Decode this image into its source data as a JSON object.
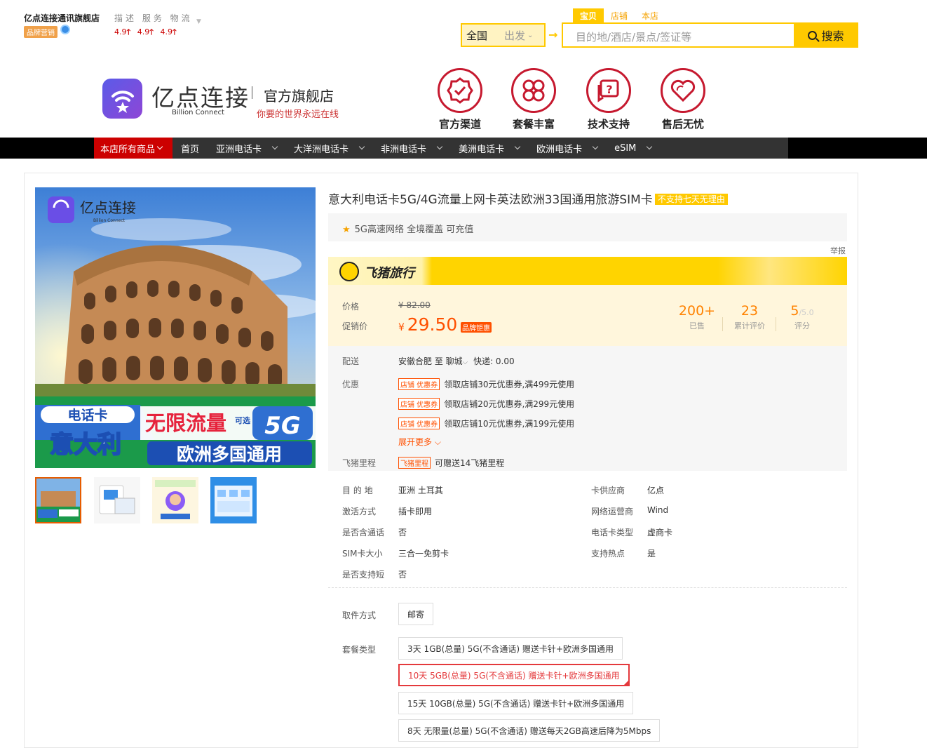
{
  "shop": {
    "name": "亿点连接通讯旗舰店",
    "badge": "品牌营销",
    "ratings_header": "描述 服务 物流",
    "ratings": [
      "4.9",
      "4.9",
      "4.9"
    ]
  },
  "search": {
    "tabs": [
      "宝贝",
      "店铺",
      "本店"
    ],
    "region": "全国",
    "depart": "出发",
    "placeholder": "目的地/酒店/景点/签证等",
    "button": "搜索"
  },
  "brand": {
    "cn": "亿点连接",
    "en": "Billion Connect",
    "flagship": "官方旗舰店",
    "slogan": "你要的世界永远在线"
  },
  "features": [
    "官方渠道",
    "套餐丰富",
    "技术支持",
    "售后无忧"
  ],
  "nav": [
    "本店所有商品",
    "首页",
    "亚洲电话卡",
    "大洋洲电话卡",
    "非洲电话卡",
    "美洲电话卡",
    "欧洲电话卡",
    "eSIM"
  ],
  "product": {
    "title": "意大利电话卡5G/4G流量上网卡英法欧洲33国通用旅游SIM卡",
    "title_badge": "不支持七天无理由",
    "highlights": "5G高速网络 全境覆盖 可充值",
    "report": "举报",
    "banner_text": "飞猪旅行",
    "price_label": "价格",
    "old_price": "¥ 82.00",
    "promo_label": "促销价",
    "currency": "¥",
    "promo_price": "29.50",
    "promo_tag": "品牌钜惠",
    "stats": [
      {
        "value": "200+",
        "label": "已售"
      },
      {
        "value": "23",
        "label": "累计评价"
      },
      {
        "value": "5",
        "suffix": "/5.0",
        "label": "评分"
      }
    ],
    "shipping_label": "配送",
    "shipping": "安徽合肥 至 聊城",
    "shipping_fee": "快递: 0.00",
    "coupon_label": "优惠",
    "coupon_tag": "店铺 优惠券",
    "coupons": [
      "领取店铺30元优惠券,满499元使用",
      "领取店铺20元优惠券,满299元使用",
      "领取店铺10元优惠券,满199元使用"
    ],
    "expand": "展开更多",
    "mileage_label": "飞猪里程",
    "mileage_tag": "飞猪里程",
    "mileage": "可赠送14飞猪里程",
    "image_text": {
      "brand": "亿点连接",
      "brand_en": "Billion Connect",
      "line1": "电话卡",
      "line2": "意大利",
      "line3": "无限流量",
      "line3b": "可选",
      "line4": "5G",
      "line5": "欧洲多国通用"
    }
  },
  "attributes": [
    {
      "label": "目 的 地",
      "value": "亚洲   土耳其"
    },
    {
      "label": "卡供应商",
      "value": "亿点"
    },
    {
      "label": "激活方式",
      "value": "插卡即用"
    },
    {
      "label": "网络运营商",
      "value": "Wind"
    },
    {
      "label": "是否含通话",
      "value": "否"
    },
    {
      "label": "电话卡类型",
      "value": "虚商卡"
    },
    {
      "label": "SIM卡大小",
      "value": "三合一免剪卡"
    },
    {
      "label": "支持热点",
      "value": "是"
    },
    {
      "label": "是否支持短",
      "value": "否"
    }
  ],
  "options": {
    "pickup_label": "取件方式",
    "pickup": "邮寄",
    "package_label": "套餐类型",
    "packages": [
      "3天 1GB(总量) 5G(不含通话) 赠送卡针+欧洲多国通用",
      "10天 5GB(总量) 5G(不含通话) 赠送卡针+欧洲多国通用",
      "15天 10GB(总量) 5G(不含通话) 赠送卡针+欧洲多国通用",
      "8天 无限量(总量) 5G(不含通话) 赠送每天2GB高速后降为5Mbps"
    ]
  }
}
